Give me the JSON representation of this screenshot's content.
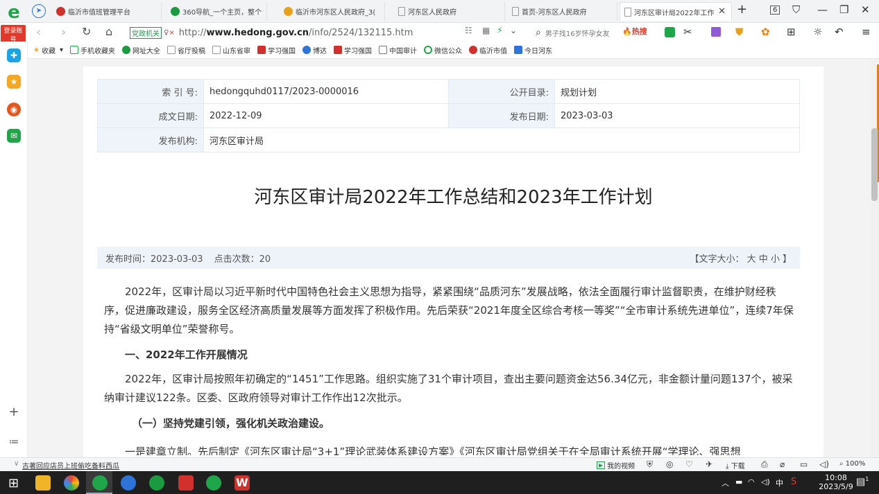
{
  "tabs": [
    {
      "label": "临沂市值班管理平台",
      "color": "#d0312d"
    },
    {
      "label": "360导航_一个主页，整个",
      "color": "#1c9a3f"
    },
    {
      "label": "临沂市河东区人民政府_3(",
      "color": "#e8a21a"
    },
    {
      "label": "河东区人民政府",
      "color": "#999999"
    },
    {
      "label": "首页-河东区人民政府",
      "color": "#999999"
    },
    {
      "label": "河东区审计局2022年工作",
      "color": "#999999"
    }
  ],
  "browser": {
    "login_badge": "登录账号",
    "gov_badge": "党政机关",
    "url_prefix": "http://",
    "url_domain": "www.hedong.gov.cn",
    "url_path": "/info/2524/132115.htm",
    "search_text": "男子找16岁怀孕女友",
    "hot_label": "热搜",
    "tab_count": "6"
  },
  "bookmarks": [
    "收藏",
    "手机收藏夹",
    "网址大全",
    "省厅投稿",
    "山东省审",
    "学习强国",
    "博达",
    "学习强国",
    "中国审计",
    "微信公众",
    "临沂市值",
    "今日河东"
  ],
  "meta": [
    {
      "k1": "索 引 号:",
      "v1": "hedongquhd0117/2023-0000016",
      "k2": "公开目录:",
      "v2": "规划计划"
    },
    {
      "k1": "成文日期:",
      "v1": "2022-12-09",
      "k2": "发布日期:",
      "v2": "2023-03-03"
    },
    {
      "k1": "发布机构:",
      "v1": "河东区审计局",
      "k2": "",
      "v2": ""
    }
  ],
  "article": {
    "title": "河东区审计局2022年工作总结和2023年工作计划",
    "publish_time": "发布时间：2023-03-03",
    "clicks": "点击次数：20",
    "font_size_ctrl": "【文字大小： 大 中 小 】",
    "p1": "2022年，区审计局以习近平新时代中国特色社会主义思想为指导，紧紧围绕“品质河东”发展战略，依法全面履行审计监督职责，在维护财经秩序，促进廉政建设，服务全区经济高质量发展等方面发挥了积极作用。先后荣获“2021年度全区综合考核一等奖”“全市审计系统先进单位”，连续7年保持“省级文明单位”荣誉称号。",
    "h2": "一、2022年工作开展情况",
    "p2": "2022年，区审计局按照年初确定的“1451”工作思路。组织实施了31个审计项目，查出主要问题资金达56.34亿元，非金额计量问题137个，被采纳审计建议122条。区委、区政府领导对审计工作作出12次批示。",
    "h3": "（一）坚持党建引领，强化机关政治建设。",
    "p3": "一是建章立制。先后制定《河东区审计局“3+1”理论武装体系建设方案》《河东区审计局党组关于在全局审计系统开展“学理论、强思想"
  },
  "status": {
    "left": "古著回应店员上班偷吃备料西瓜",
    "video": "我的视频",
    "download": "下载",
    "zoom": "100%"
  },
  "taskbar": {
    "time": "10:08",
    "date": "2023/5/9",
    "ime": "中",
    "notif": "1"
  }
}
